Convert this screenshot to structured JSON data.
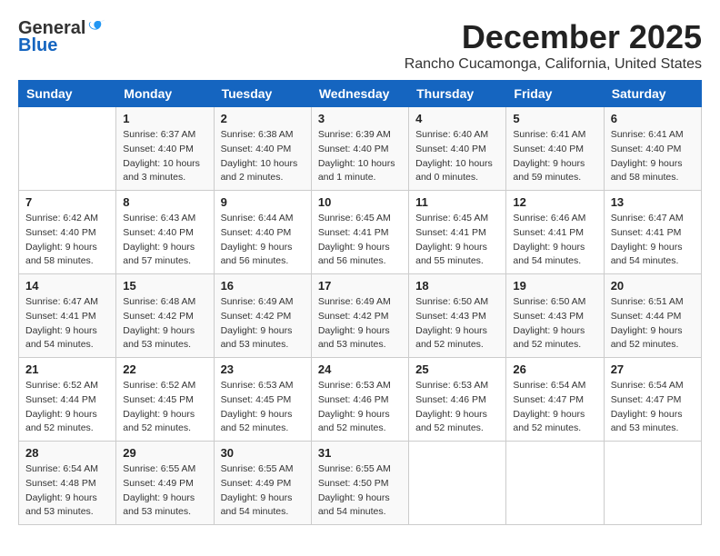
{
  "header": {
    "logo_general": "General",
    "logo_blue": "Blue",
    "month": "December 2025",
    "location": "Rancho Cucamonga, California, United States"
  },
  "days_of_week": [
    "Sunday",
    "Monday",
    "Tuesday",
    "Wednesday",
    "Thursday",
    "Friday",
    "Saturday"
  ],
  "weeks": [
    [
      {
        "day": "",
        "info": ""
      },
      {
        "day": "1",
        "info": "Sunrise: 6:37 AM\nSunset: 4:40 PM\nDaylight: 10 hours\nand 3 minutes."
      },
      {
        "day": "2",
        "info": "Sunrise: 6:38 AM\nSunset: 4:40 PM\nDaylight: 10 hours\nand 2 minutes."
      },
      {
        "day": "3",
        "info": "Sunrise: 6:39 AM\nSunset: 4:40 PM\nDaylight: 10 hours\nand 1 minute."
      },
      {
        "day": "4",
        "info": "Sunrise: 6:40 AM\nSunset: 4:40 PM\nDaylight: 10 hours\nand 0 minutes."
      },
      {
        "day": "5",
        "info": "Sunrise: 6:41 AM\nSunset: 4:40 PM\nDaylight: 9 hours\nand 59 minutes."
      },
      {
        "day": "6",
        "info": "Sunrise: 6:41 AM\nSunset: 4:40 PM\nDaylight: 9 hours\nand 58 minutes."
      }
    ],
    [
      {
        "day": "7",
        "info": "Sunrise: 6:42 AM\nSunset: 4:40 PM\nDaylight: 9 hours\nand 58 minutes."
      },
      {
        "day": "8",
        "info": "Sunrise: 6:43 AM\nSunset: 4:40 PM\nDaylight: 9 hours\nand 57 minutes."
      },
      {
        "day": "9",
        "info": "Sunrise: 6:44 AM\nSunset: 4:40 PM\nDaylight: 9 hours\nand 56 minutes."
      },
      {
        "day": "10",
        "info": "Sunrise: 6:45 AM\nSunset: 4:41 PM\nDaylight: 9 hours\nand 56 minutes."
      },
      {
        "day": "11",
        "info": "Sunrise: 6:45 AM\nSunset: 4:41 PM\nDaylight: 9 hours\nand 55 minutes."
      },
      {
        "day": "12",
        "info": "Sunrise: 6:46 AM\nSunset: 4:41 PM\nDaylight: 9 hours\nand 54 minutes."
      },
      {
        "day": "13",
        "info": "Sunrise: 6:47 AM\nSunset: 4:41 PM\nDaylight: 9 hours\nand 54 minutes."
      }
    ],
    [
      {
        "day": "14",
        "info": "Sunrise: 6:47 AM\nSunset: 4:41 PM\nDaylight: 9 hours\nand 54 minutes."
      },
      {
        "day": "15",
        "info": "Sunrise: 6:48 AM\nSunset: 4:42 PM\nDaylight: 9 hours\nand 53 minutes."
      },
      {
        "day": "16",
        "info": "Sunrise: 6:49 AM\nSunset: 4:42 PM\nDaylight: 9 hours\nand 53 minutes."
      },
      {
        "day": "17",
        "info": "Sunrise: 6:49 AM\nSunset: 4:42 PM\nDaylight: 9 hours\nand 53 minutes."
      },
      {
        "day": "18",
        "info": "Sunrise: 6:50 AM\nSunset: 4:43 PM\nDaylight: 9 hours\nand 52 minutes."
      },
      {
        "day": "19",
        "info": "Sunrise: 6:50 AM\nSunset: 4:43 PM\nDaylight: 9 hours\nand 52 minutes."
      },
      {
        "day": "20",
        "info": "Sunrise: 6:51 AM\nSunset: 4:44 PM\nDaylight: 9 hours\nand 52 minutes."
      }
    ],
    [
      {
        "day": "21",
        "info": "Sunrise: 6:52 AM\nSunset: 4:44 PM\nDaylight: 9 hours\nand 52 minutes."
      },
      {
        "day": "22",
        "info": "Sunrise: 6:52 AM\nSunset: 4:45 PM\nDaylight: 9 hours\nand 52 minutes."
      },
      {
        "day": "23",
        "info": "Sunrise: 6:53 AM\nSunset: 4:45 PM\nDaylight: 9 hours\nand 52 minutes."
      },
      {
        "day": "24",
        "info": "Sunrise: 6:53 AM\nSunset: 4:46 PM\nDaylight: 9 hours\nand 52 minutes."
      },
      {
        "day": "25",
        "info": "Sunrise: 6:53 AM\nSunset: 4:46 PM\nDaylight: 9 hours\nand 52 minutes."
      },
      {
        "day": "26",
        "info": "Sunrise: 6:54 AM\nSunset: 4:47 PM\nDaylight: 9 hours\nand 52 minutes."
      },
      {
        "day": "27",
        "info": "Sunrise: 6:54 AM\nSunset: 4:47 PM\nDaylight: 9 hours\nand 53 minutes."
      }
    ],
    [
      {
        "day": "28",
        "info": "Sunrise: 6:54 AM\nSunset: 4:48 PM\nDaylight: 9 hours\nand 53 minutes."
      },
      {
        "day": "29",
        "info": "Sunrise: 6:55 AM\nSunset: 4:49 PM\nDaylight: 9 hours\nand 53 minutes."
      },
      {
        "day": "30",
        "info": "Sunrise: 6:55 AM\nSunset: 4:49 PM\nDaylight: 9 hours\nand 54 minutes."
      },
      {
        "day": "31",
        "info": "Sunrise: 6:55 AM\nSunset: 4:50 PM\nDaylight: 9 hours\nand 54 minutes."
      },
      {
        "day": "",
        "info": ""
      },
      {
        "day": "",
        "info": ""
      },
      {
        "day": "",
        "info": ""
      }
    ]
  ]
}
